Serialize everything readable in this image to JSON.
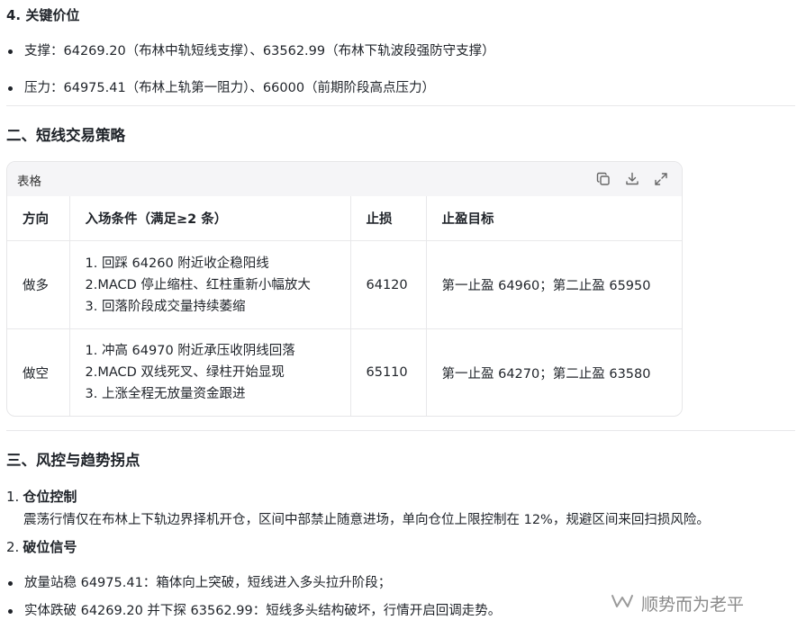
{
  "section4": {
    "title": "4. 关键价位",
    "items": [
      "支撑：64269.20（布林中轨短线支撑）、63562.99（布林下轨波段强防守支撑）",
      "压力：64975.41（布林上轨第一阻力）、66000（前期阶段高点压力）"
    ]
  },
  "section2": {
    "title": "二、短线交易策略",
    "table_label": "表格",
    "icons": [
      "copy-icon",
      "download-icon",
      "expand-icon"
    ],
    "headers": [
      "方向",
      "入场条件（满足≥2 条）",
      "止损",
      "止盈目标"
    ],
    "rows": [
      {
        "direction": "做多",
        "conditions": [
          "1. 回踩 64260 附近收企稳阳线",
          "2.MACD 停止缩柱、红柱重新小幅放大",
          "3. 回落阶段成交量持续萎缩"
        ],
        "stop": "64120",
        "target": "第一止盈 64960；第二止盈 65950"
      },
      {
        "direction": "做空",
        "conditions": [
          "1. 冲高 64970 附近承压收阴线回落",
          "2.MACD 双线死叉、绿柱开始显现",
          "3. 上涨全程无放量资金跟进"
        ],
        "stop": "65110",
        "target": "第一止盈 64270；第二止盈 63580"
      }
    ]
  },
  "section3": {
    "title": "三、风控与趋势拐点",
    "item1": {
      "num": "1.",
      "title": "仓位控制",
      "body": "震荡行情仅在布林上下轨边界择机开仓，区间中部禁止随意进场，单向仓位上限控制在 12%，规避区间来回扫损风险。"
    },
    "item2": {
      "num": "2.",
      "title": "破位信号"
    },
    "bullets": [
      "放量站稳 64975.41：箱体向上突破，短线进入多头拉升阶段；",
      "实体跌破 64269.20 并下探 63562.99：短线多头结构破坏，行情开启回调走势。"
    ]
  },
  "watermark": {
    "text": "顺势而为老平",
    "icon": "wechat-channel-icon"
  }
}
